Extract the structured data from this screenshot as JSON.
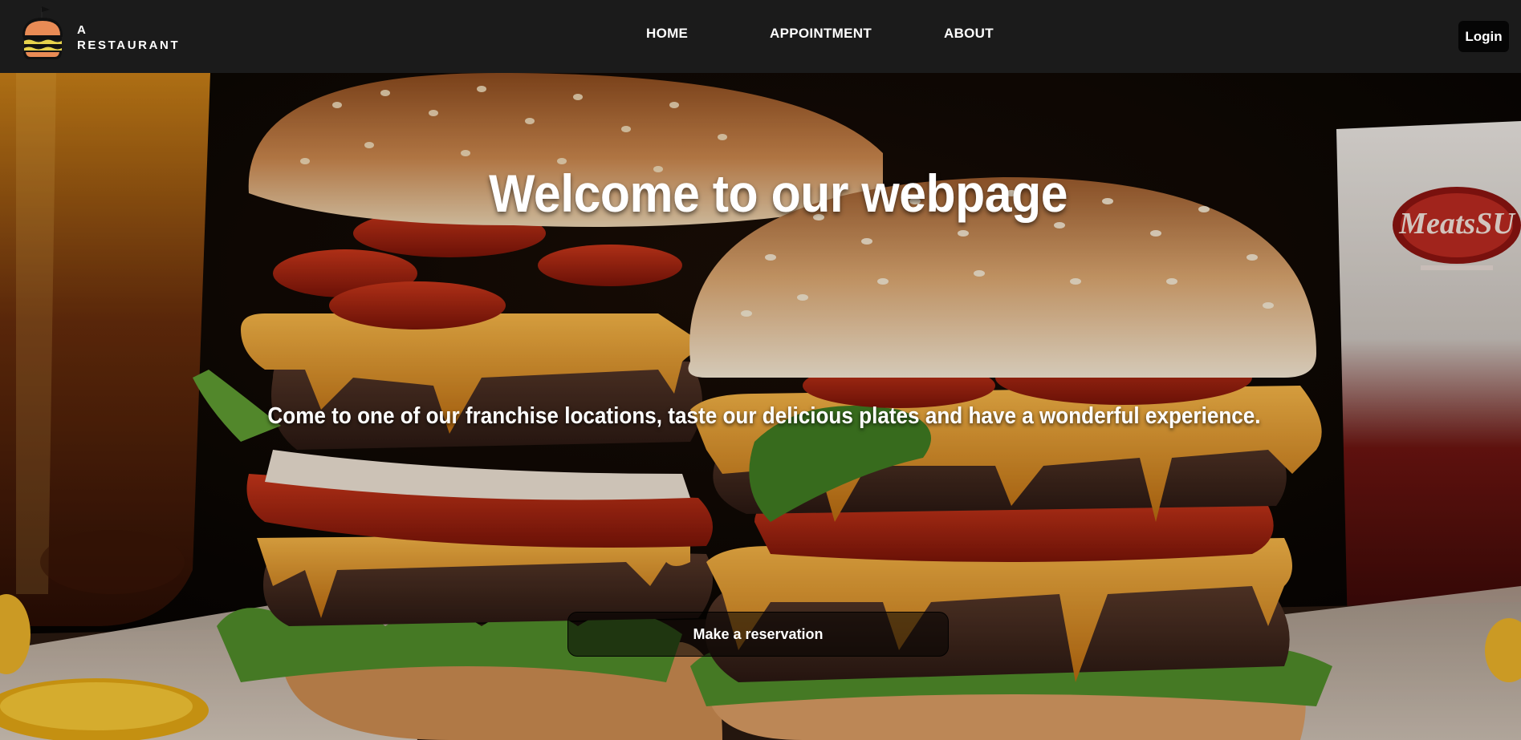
{
  "brand": {
    "line1": "A",
    "line2": "RESTAURANT",
    "logo_icon": "burger-logo-icon"
  },
  "nav": {
    "items": [
      {
        "label": "HOME"
      },
      {
        "label": "APPOINTMENT"
      },
      {
        "label": "ABOUT"
      }
    ]
  },
  "header": {
    "login_label": "Login"
  },
  "hero": {
    "title": "Welcome to our webpage",
    "subtitle": "Come to one of our franchise locations, taste our delicious plates and have a wonderful experience.",
    "cta_label": "Make a reservation",
    "cup_text": "MeatsSU"
  },
  "colors": {
    "header_bg": "#1b1b1b",
    "login_bg": "#050505",
    "text": "#ffffff",
    "bun": "#d08a4a",
    "cheese": "#e69a2a",
    "tomato": "#b52a12",
    "lettuce": "#4f8a2a"
  }
}
